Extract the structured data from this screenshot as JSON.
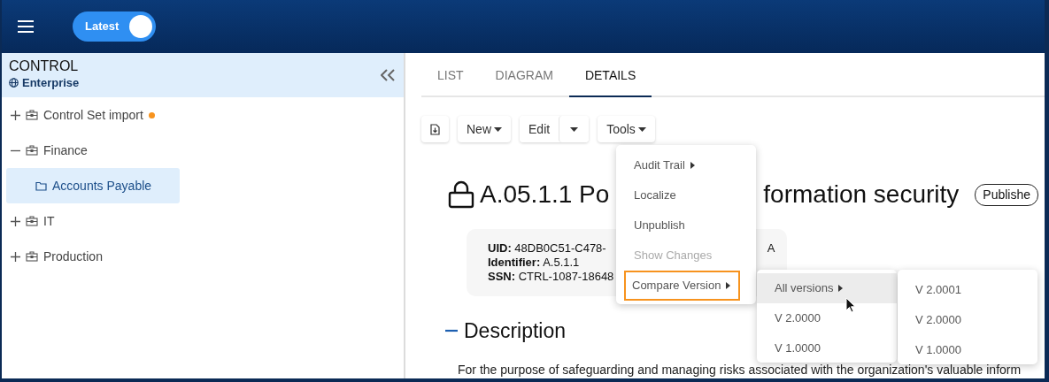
{
  "header": {
    "toggle": {
      "label": "Latest",
      "on": true
    }
  },
  "sidebar": {
    "title": "CONTROL",
    "scope": "Enterprise",
    "tree": [
      {
        "label": "Control Set import",
        "kind": "group",
        "expanded": false,
        "flagged": true,
        "selected": false
      },
      {
        "label": "Finance",
        "kind": "group",
        "expanded": true,
        "flagged": false,
        "selected": false,
        "children": [
          {
            "label": "Accounts Payable",
            "kind": "folder",
            "flagged": false,
            "selected": true
          }
        ]
      },
      {
        "label": "IT",
        "kind": "group",
        "expanded": false,
        "flagged": false,
        "selected": false
      },
      {
        "label": "Production",
        "kind": "group",
        "expanded": false,
        "flagged": false,
        "selected": false
      }
    ]
  },
  "tabs": [
    {
      "label": "LIST",
      "selected": false
    },
    {
      "label": "DIAGRAM",
      "selected": false
    },
    {
      "label": "DETAILS",
      "selected": true
    }
  ],
  "toolbar": [
    {
      "kind": "icon"
    },
    {
      "kind": "dropdown",
      "label": "New"
    },
    {
      "kind": "split",
      "label": "Edit"
    },
    {
      "kind": "dropdown",
      "label": "Tools"
    }
  ],
  "record": {
    "title_start": "A.05.1.1 Po",
    "title_end": "formation security",
    "status": "Publishe",
    "fields": [
      {
        "label": "UID:",
        "value": "48DB0C51-C478-",
        "value_end": "A"
      },
      {
        "label": "Identifier:",
        "value": "A.5.1.1"
      },
      {
        "label": "SSN:",
        "value": "CTRL-1087-18648"
      }
    ],
    "section": {
      "heading": "Description",
      "expanded": true,
      "text": "For the purpose of safeguarding and managing risks associated with the organization's valuable inform"
    }
  },
  "tools_menu": [
    {
      "label": "Audit Trail",
      "submenu": true,
      "disabled": false,
      "highlighted": false
    },
    {
      "label": "Localize",
      "submenu": false,
      "disabled": false,
      "highlighted": false
    },
    {
      "label": "Unpublish",
      "submenu": false,
      "disabled": false,
      "highlighted": false
    },
    {
      "label": "Show Changes",
      "submenu": false,
      "disabled": true,
      "highlighted": false
    },
    {
      "label": "Compare Version",
      "submenu": true,
      "disabled": false,
      "highlighted": true
    }
  ],
  "compare_menu": [
    {
      "label": "All versions",
      "submenu": true,
      "hovered": true
    },
    {
      "label": "V 2.0000",
      "submenu": false,
      "hovered": false
    },
    {
      "label": "V 1.0000",
      "submenu": false,
      "hovered": false
    }
  ],
  "versions_menu": [
    {
      "label": "V 2.0001"
    },
    {
      "label": "V 2.0000"
    },
    {
      "label": "V 1.0000"
    }
  ]
}
